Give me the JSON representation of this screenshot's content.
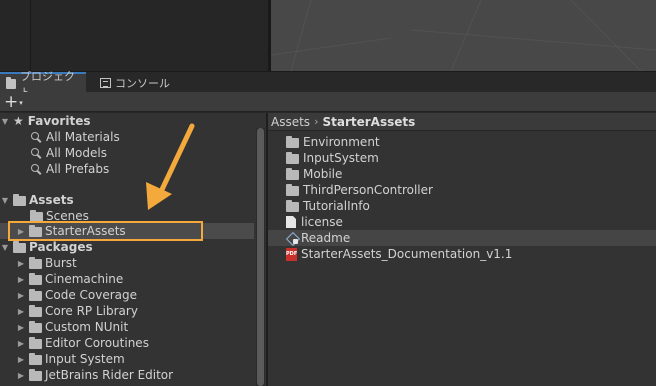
{
  "tabs": {
    "project": "プロジェクト",
    "console": "コンソール"
  },
  "toolbar": {
    "add_label": "+",
    "add_caret": "▾"
  },
  "tree": {
    "favorites": {
      "label": "Favorites",
      "items": [
        "All Materials",
        "All Models",
        "All Prefabs"
      ]
    },
    "assets": {
      "label": "Assets",
      "items": [
        "Scenes",
        "StarterAssets"
      ]
    },
    "packages": {
      "label": "Packages",
      "items": [
        "Burst",
        "Cinemachine",
        "Code Coverage",
        "Core RP Library",
        "Custom NUnit",
        "Editor Coroutines",
        "Input System",
        "JetBrains Rider Editor"
      ]
    }
  },
  "breadcrumb": {
    "root": "Assets",
    "separator": "›",
    "current": "StarterAssets"
  },
  "contents": [
    {
      "label": "Environment",
      "icon": "folder-icon"
    },
    {
      "label": "InputSystem",
      "icon": "folder-icon"
    },
    {
      "label": "Mobile",
      "icon": "folder-icon"
    },
    {
      "label": "ThirdPersonController",
      "icon": "folder-icon"
    },
    {
      "label": "TutorialInfo",
      "icon": "folder-icon"
    },
    {
      "label": "license",
      "icon": "document-icon"
    },
    {
      "label": "Readme",
      "icon": "scriptable-object-icon"
    },
    {
      "label": "StarterAssets_Documentation_v1.1",
      "icon": "pdf-icon"
    }
  ],
  "colors": {
    "highlight": "#f4a93d",
    "arrow": "#f4a93d",
    "tab_accent": "#3a79bb"
  }
}
